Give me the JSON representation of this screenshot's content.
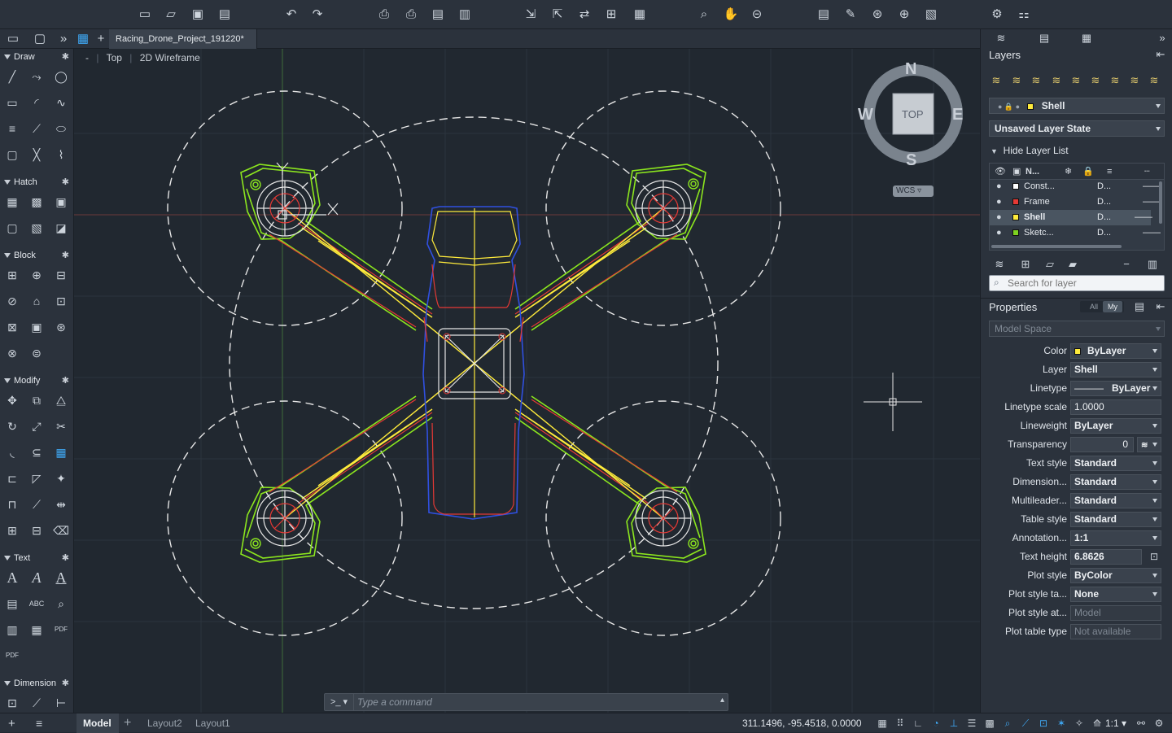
{
  "document": {
    "tab_title": "Racing_Drone_Project_191220*"
  },
  "viewport": {
    "minus": "-",
    "view": "Top",
    "style": "2D Wireframe"
  },
  "viewcube": {
    "north": "N",
    "south": "S",
    "east": "E",
    "west": "W",
    "face": "TOP",
    "ucs": "WCS"
  },
  "palette": {
    "sections": [
      "Draw",
      "Hatch",
      "Block",
      "Modify",
      "Text",
      "Dimension"
    ]
  },
  "command": {
    "prompt": ">_",
    "placeholder": "Type a command"
  },
  "status": {
    "tabs": [
      "Model",
      "Layout2",
      "Layout1"
    ],
    "add_tab": "+",
    "coordinates": "311.1496,  -95.4518, 0.0000",
    "scale": "1:1"
  },
  "layers_panel": {
    "title": "Layers",
    "current_layer": "Shell",
    "layer_state": "Unsaved Layer State",
    "hide_list": "Hide Layer List",
    "col_name": "N...",
    "rows": [
      {
        "name": "Const...",
        "desc": "D...",
        "color": "#ffffff"
      },
      {
        "name": "Frame",
        "desc": "D...",
        "color": "#e53935"
      },
      {
        "name": "Shell",
        "desc": "D...",
        "color": "#ffeb3b"
      },
      {
        "name": "Sketc...",
        "desc": "D...",
        "color": "#7ed321"
      }
    ],
    "search_placeholder": "Search for layer"
  },
  "properties_panel": {
    "title": "Properties",
    "filter_all": "All",
    "filter_my": "My",
    "space": "Model Space",
    "rows": [
      {
        "label": "Color",
        "value": "ByLayer"
      },
      {
        "label": "Layer",
        "value": "Shell"
      },
      {
        "label": "Linetype",
        "value": "ByLayer"
      },
      {
        "label": "Linetype scale",
        "value": "1.0000"
      },
      {
        "label": "Lineweight",
        "value": "ByLayer"
      },
      {
        "label": "Transparency",
        "value": "0"
      },
      {
        "label": "Text style",
        "value": "Standard"
      },
      {
        "label": "Dimension...",
        "value": "Standard"
      },
      {
        "label": "Multileader...",
        "value": "Standard"
      },
      {
        "label": "Table style",
        "value": "Standard"
      },
      {
        "label": "Annotation...",
        "value": "1:1"
      },
      {
        "label": "Text height",
        "value": "6.8626"
      },
      {
        "label": "Plot style",
        "value": "ByColor"
      },
      {
        "label": "Plot style ta...",
        "value": "None"
      },
      {
        "label": "Plot style at...",
        "value": "Model"
      },
      {
        "label": "Plot table type",
        "value": "Not available"
      }
    ]
  },
  "colors": {
    "accent": "#3fa9f5",
    "frame": "#e53935",
    "shell": "#ffeb3b",
    "sketch": "#7ed321",
    "body": "#2f4bd8"
  }
}
